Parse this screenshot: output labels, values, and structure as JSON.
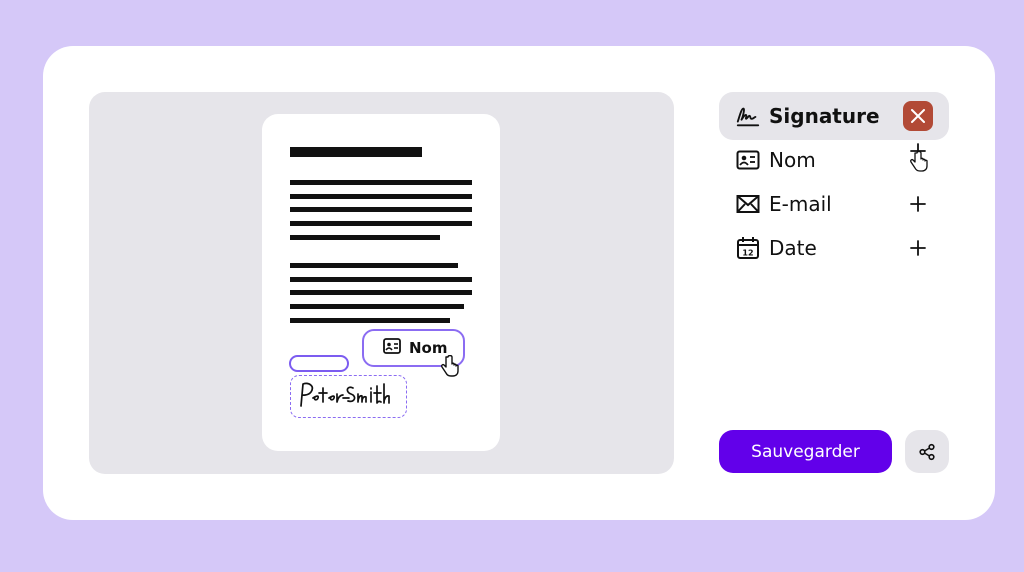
{
  "document": {
    "name_chip_label": "Nom",
    "signature_text": "Peter Smith"
  },
  "panel": {
    "items": [
      {
        "label": "Signature",
        "icon": "signature-icon",
        "action": "close-icon"
      },
      {
        "label": "Nom",
        "icon": "id-card-icon",
        "action": "plus-icon"
      },
      {
        "label": "E-mail",
        "icon": "envelope-icon",
        "action": "plus-icon"
      },
      {
        "label": "Date",
        "icon": "calendar-icon",
        "action": "plus-icon",
        "icon_text": "12"
      }
    ]
  },
  "actions": {
    "save_label": "Sauvegarder",
    "share_icon": "share-icon"
  },
  "colors": {
    "background": "#d5c8f8",
    "accent": "#6200ea",
    "close": "#b24a36",
    "field_outline": "#8b6cf2"
  }
}
